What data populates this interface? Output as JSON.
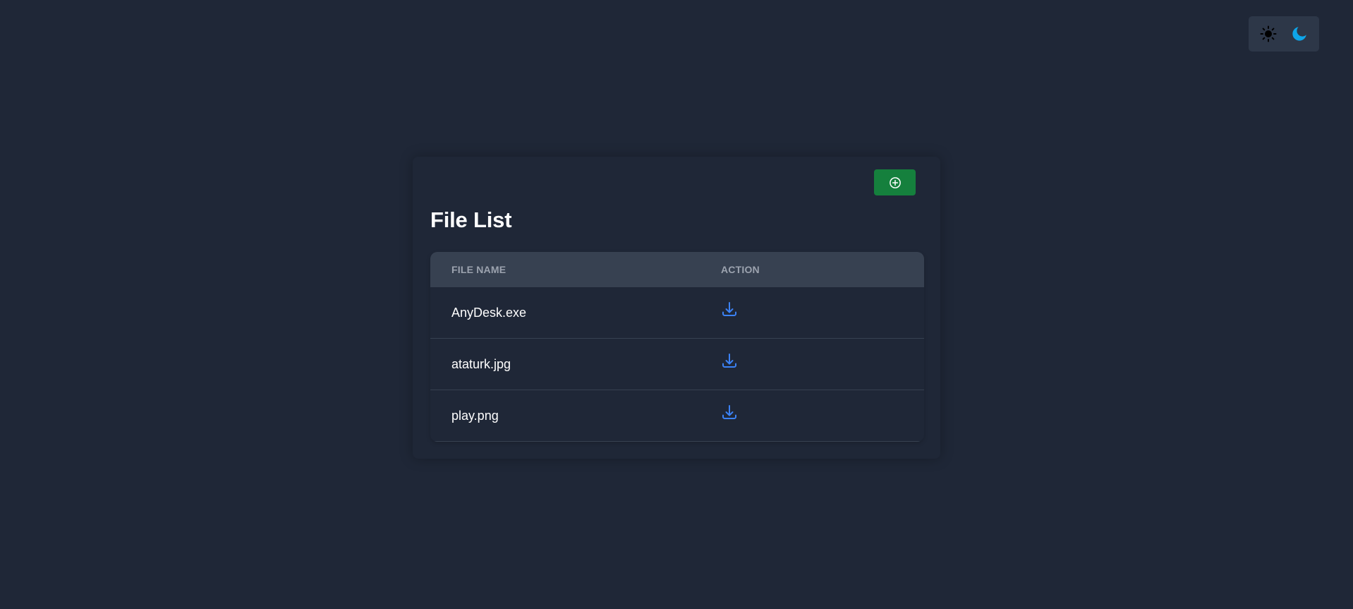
{
  "theme_toggle": {
    "light_icon": "sun-icon",
    "dark_icon": "moon-icon",
    "dark_color": "#0ea5e9"
  },
  "toolbar": {
    "add_icon": "plus-circle-icon",
    "add_color": "#15803d"
  },
  "page": {
    "title": "File List"
  },
  "table": {
    "headers": {
      "file_name": "FILE NAME",
      "action": "ACTION"
    },
    "rows": [
      {
        "file_name": "AnyDesk.exe",
        "action_icon": "download-icon"
      },
      {
        "file_name": "ataturk.jpg",
        "action_icon": "download-icon"
      },
      {
        "file_name": "play.png",
        "action_icon": "download-icon"
      }
    ],
    "action_color": "#3b82f6"
  }
}
